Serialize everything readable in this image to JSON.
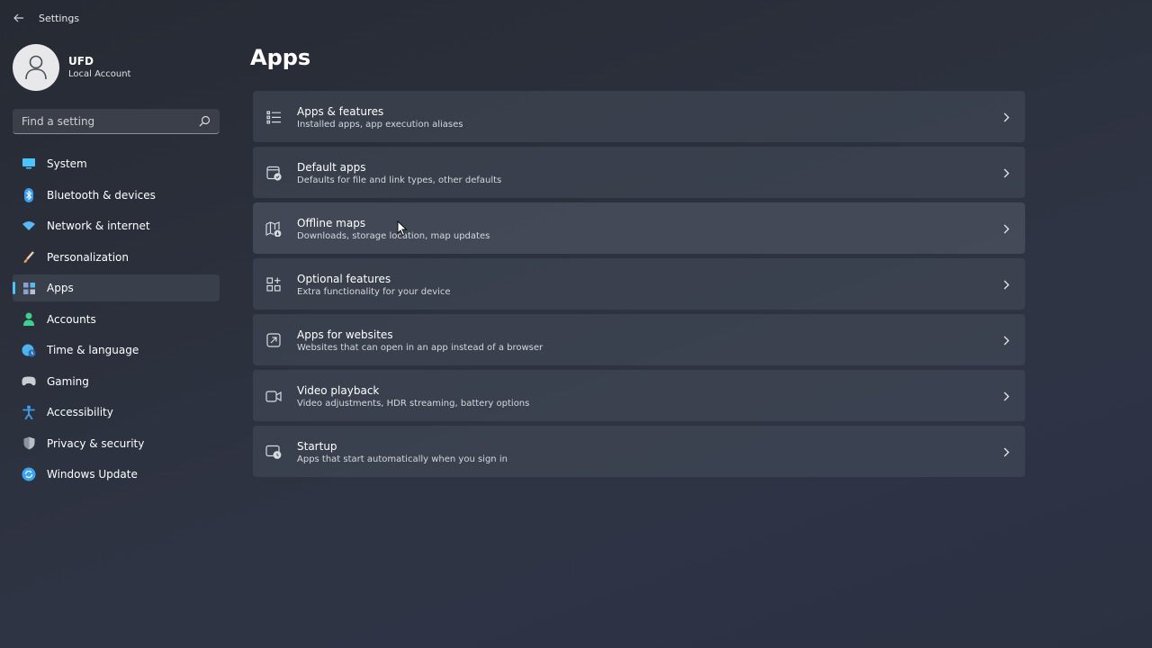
{
  "window": {
    "title": "Settings"
  },
  "profile": {
    "name": "UFD",
    "account_type": "Local Account"
  },
  "search": {
    "placeholder": "Find a setting"
  },
  "sidebar": {
    "items": [
      {
        "label": "System",
        "icon": "monitor-icon",
        "color": "#4cc2ff"
      },
      {
        "label": "Bluetooth & devices",
        "icon": "bluetooth-icon",
        "color": "#3b9cf5"
      },
      {
        "label": "Network & internet",
        "icon": "wifi-icon",
        "color": "#5ab8f5"
      },
      {
        "label": "Personalization",
        "icon": "brush-icon",
        "color": "#f0a050"
      },
      {
        "label": "Apps",
        "icon": "apps-icon",
        "color": "#9aa7c7",
        "active": true
      },
      {
        "label": "Accounts",
        "icon": "person-icon",
        "color": "#3fcf8e"
      },
      {
        "label": "Time & language",
        "icon": "globe-clock-icon",
        "color": "#4fb3f0"
      },
      {
        "label": "Gaming",
        "icon": "gamepad-icon",
        "color": "#c9ccd3"
      },
      {
        "label": "Accessibility",
        "icon": "accessibility-icon",
        "color": "#3f9bf0"
      },
      {
        "label": "Privacy & security",
        "icon": "shield-icon",
        "color": "#b9bdc6"
      },
      {
        "label": "Windows Update",
        "icon": "sync-icon",
        "color": "#3aa5f5"
      }
    ]
  },
  "main": {
    "title": "Apps",
    "cards": [
      {
        "title": "Apps & features",
        "subtitle": "Installed apps, app execution aliases",
        "icon": "list-icon"
      },
      {
        "title": "Default apps",
        "subtitle": "Defaults for file and link types, other defaults",
        "icon": "default-apps-icon"
      },
      {
        "title": "Offline maps",
        "subtitle": "Downloads, storage location, map updates",
        "icon": "map-icon"
      },
      {
        "title": "Optional features",
        "subtitle": "Extra functionality for your device",
        "icon": "grid-plus-icon"
      },
      {
        "title": "Apps for websites",
        "subtitle": "Websites that can open in an app instead of a browser",
        "icon": "open-external-icon"
      },
      {
        "title": "Video playback",
        "subtitle": "Video adjustments, HDR streaming, battery options",
        "icon": "video-icon"
      },
      {
        "title": "Startup",
        "subtitle": "Apps that start automatically when you sign in",
        "icon": "startup-icon"
      }
    ]
  },
  "colors": {
    "accent": "#4cc2ff"
  }
}
